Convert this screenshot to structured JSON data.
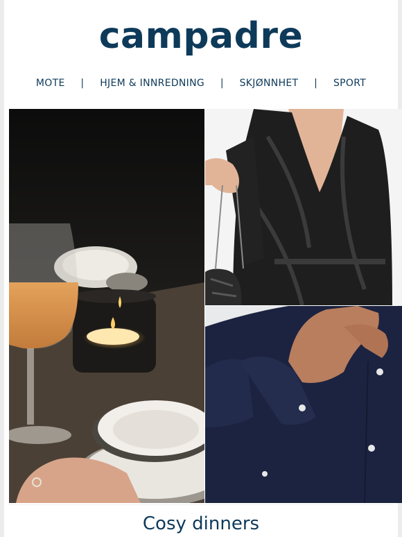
{
  "brand": {
    "logo_text": "campadre",
    "color": "#0e3a5a"
  },
  "nav": {
    "items": [
      "MOTE",
      "HJEM & INNREDNING",
      "SKJØNNHET",
      "SPORT"
    ],
    "separator": "|"
  },
  "images": {
    "dinner": "candlelit dinner table with wine glass",
    "dress": "woman in black metallic wrap dress",
    "shirt": "navy button-up shirt"
  },
  "caption": "Cosy dinners"
}
